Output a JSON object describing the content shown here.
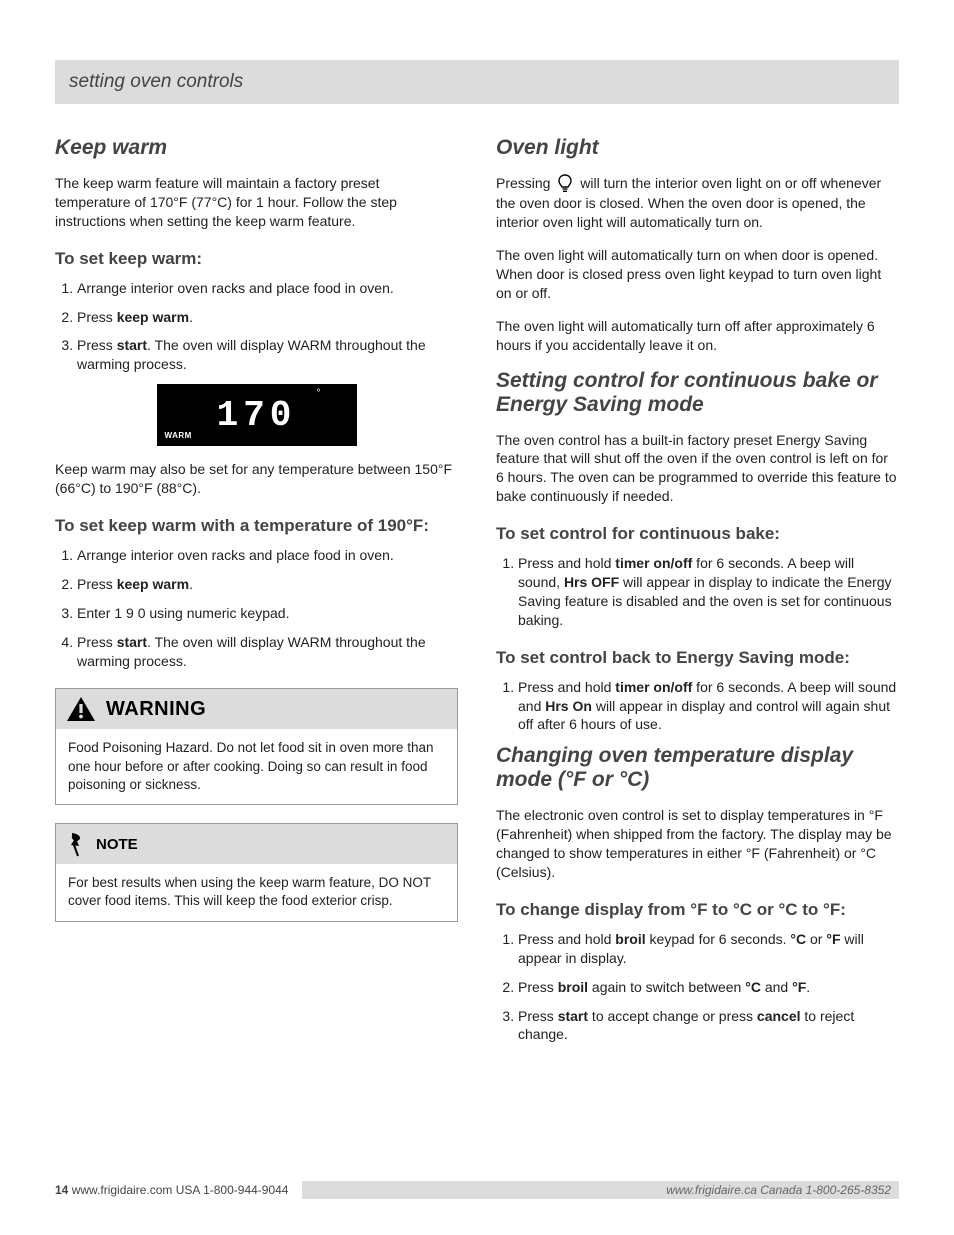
{
  "header": "setting oven controls",
  "left": {
    "kw_heading": "Keep warm",
    "kw_intro": "The keep warm feature will maintain a factory preset temperature of 170°F (77°C) for 1 hour. Follow the step instructions when setting the keep warm feature.",
    "kw_sub1": "To set keep warm:",
    "kw_steps1": [
      "Arrange interior oven racks and place food in oven.",
      "Press ",
      "Press "
    ],
    "kw_label": "keep warm",
    "start_label": "start",
    "kw_step2_tail": ".",
    "kw_step3_tail": ". The oven will display WARM throughout the warming process.",
    "display_warm": "WARM",
    "display_temp": "170",
    "display_deg": "°",
    "kw_range": "Keep warm may also be set for any temperature between 150°F (66°C) to 190°F (88°C).",
    "kw_sub2": "To set keep warm with a temperature of 190°F:",
    "kw_steps2": [
      "Arrange interior oven racks and place food in oven.",
      "Press ",
      "Enter 1  9  0 using numeric keypad.",
      "Press "
    ],
    "kw_step2b_tail": ".",
    "kw_step4b_tail": ". The oven will display WARM throughout the warming process.",
    "warning_label": "WARNING",
    "warning_body": "Food Poisoning Hazard. Do not let food sit in oven more than one hour before or after cooking. Doing so can result in food poisoning or sickness.",
    "note_label": "NOTE",
    "note_body": "For best results when using the keep warm feature, DO NOT cover food items. This will keep the food exterior crisp."
  },
  "right": {
    "light_heading": "Oven light",
    "light_p1_a": "Pressing ",
    "light_p1_b": " will turn the interior oven light on or off whenever the oven door is closed. When the oven door is opened, the interior oven light will automatically turn on.",
    "light_p2": "The oven light will automatically turn on when door is opened. When door is closed press oven light keypad to turn oven light on or off.",
    "light_p3": "The oven light will automatically turn off after approximately 6 hours if you accidentally leave it on.",
    "control_heading": "Setting control for continuous bake or Energy Saving mode",
    "cb_p1": "The oven control has a built-in factory preset Energy Saving feature that will shut off the oven if the oven control is left on for 6 hours. The oven can be programmed to override this feature to bake continuously if needed.",
    "cb_sub1": "To set control for continuous bake:",
    "cb_step1_a": "Press and hold ",
    "cb_step1_b": "timer on/off",
    "cb_step1_c": " for 6 seconds. A beep will sound, ",
    "cb_step1_d": "Hrs OFF",
    "cb_step1_e": " will appear in display to indicate the Energy Saving feature is disabled and the oven is set for continuous baking.",
    "cb_sub2": "To set control back to Energy Saving mode:",
    "cb_step2_a": "Press and hold ",
    "cb_step2_b": "timer on/off",
    "cb_step2_c": " for 6 seconds. A beep will sound and ",
    "cb_step2_d": "Hrs On",
    "cb_step2_e": " will appear in display and control will again shut off after 6 hours of use.",
    "temp_heading": "Changing oven temperature display mode (°F or °C)",
    "temp_p1": "The electronic oven control is set to display temperatures in °F (Fahrenheit) when shipped from the factory. The display may be changed to show temperatures in either °F (Fahrenheit) or °C (Celsius).",
    "temp_sub1": "To change display from °F to °C or °C to °F:",
    "temp_steps": [
      {
        "a": "Press and hold ",
        "b": "broil",
        "c": " keypad for 6 seconds. ",
        "d": "°C",
        "e": " or ",
        "f": "°F",
        "g": " will appear in display."
      },
      {
        "a": "Press ",
        "b": "broil",
        "c": " again to switch between ",
        "d": "°C",
        "e": " and ",
        "f": "°F",
        "g": "."
      },
      {
        "a": "Press ",
        "b": "start",
        "c": " to accept change or press ",
        "d": "cancel",
        "e": " to reject change.",
        "f": "",
        "g": ""
      }
    ]
  },
  "footer": {
    "page": "14",
    "site": "  www.frigidaire.com   USA 1-800-944-9044",
    "right": "www.frigidaire.ca   Canada 1-800-265-8352"
  }
}
